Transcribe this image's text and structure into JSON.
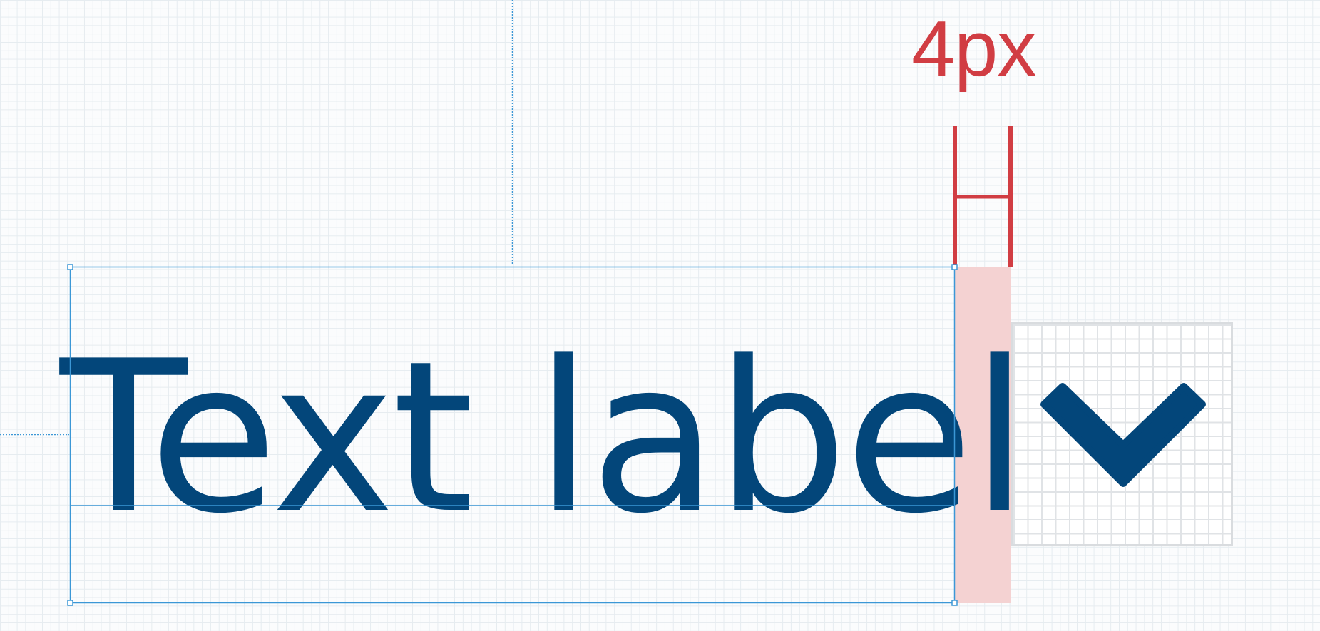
{
  "measurement": {
    "label": "4px",
    "color": "#d13d43"
  },
  "text_label": {
    "text": "Text label",
    "color": "#03467a"
  },
  "icon": {
    "name": "checkmark-icon",
    "color": "#03467a"
  },
  "colors": {
    "selection": "#3b97d6",
    "spacing_fill": "#f4d2d2",
    "grid": "#e6ecf0"
  }
}
